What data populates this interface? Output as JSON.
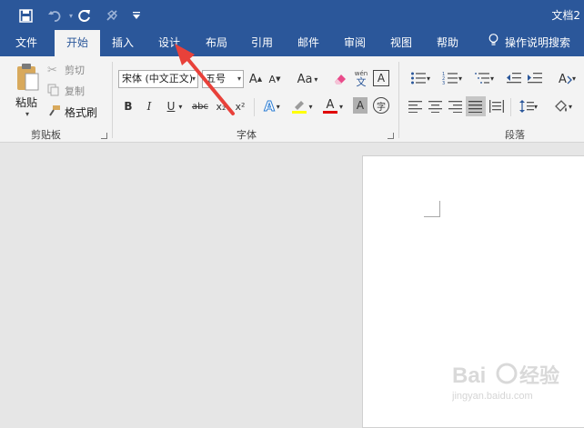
{
  "window": {
    "doc_title": "文档2"
  },
  "quick_access": [
    {
      "name": "save-icon",
      "glyph": "💾"
    },
    {
      "name": "undo-icon",
      "glyph": "↶"
    },
    {
      "name": "redo-icon",
      "glyph": "↻"
    },
    {
      "name": "format-painter-qa-icon",
      "glyph": "✓"
    },
    {
      "name": "customize-qa-icon",
      "glyph": "▾"
    }
  ],
  "tabs": [
    {
      "label": "文件"
    },
    {
      "label": "开始",
      "active": true
    },
    {
      "label": "插入"
    },
    {
      "label": "设计"
    },
    {
      "label": "布局"
    },
    {
      "label": "引用"
    },
    {
      "label": "邮件"
    },
    {
      "label": "审阅"
    },
    {
      "label": "视图"
    },
    {
      "label": "帮助"
    }
  ],
  "tell_me": {
    "label": "操作说明搜索"
  },
  "clipboard": {
    "paste_label": "粘贴",
    "cut_label": "剪切",
    "copy_label": "复制",
    "format_painter_label": "格式刷",
    "group_label": "剪贴板"
  },
  "font": {
    "font_name": "宋体 (中文正文)",
    "font_size": "五号",
    "group_label": "字体",
    "bold": "B",
    "italic": "I",
    "underline": "U",
    "strike": "abc",
    "subscript": "x₂",
    "superscript": "x²",
    "change_case": "Aa",
    "phonetic_top": "wén",
    "phonetic_bottom": "文",
    "border_char": "A",
    "shading_char": "A",
    "enclose_char": "字",
    "grow": "A",
    "shrink": "A",
    "text_effect": "A",
    "font_color": "A"
  },
  "paragraph": {
    "group_label": "段落"
  },
  "colors": {
    "brand": "#2b579a",
    "highlight": "#ffff00",
    "font_color": "#e00000",
    "arrow": "#e8413a"
  }
}
